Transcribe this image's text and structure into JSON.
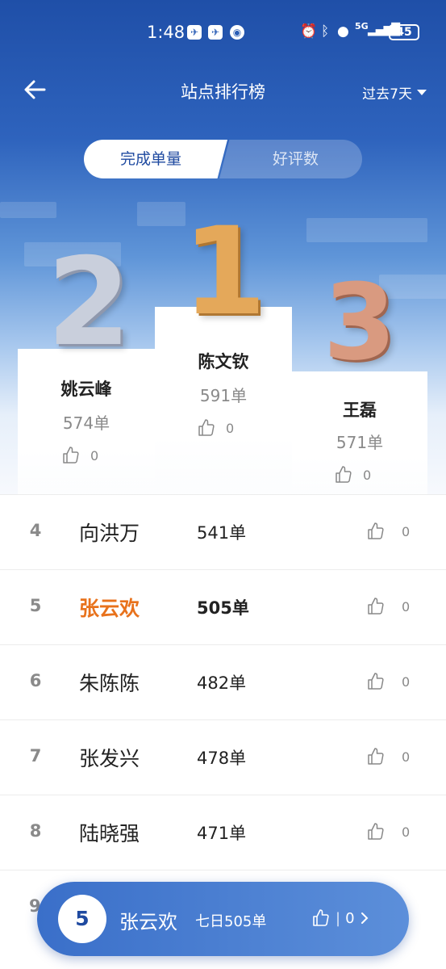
{
  "status_bar": {
    "time": "1:48",
    "battery": "45",
    "network": "5G"
  },
  "nav": {
    "title": "站点排行榜",
    "period": "过去7天"
  },
  "tabs": {
    "active": "完成单量",
    "inactive": "好评数"
  },
  "podium": {
    "first": {
      "rank_digit": "1",
      "name": "陈文钦",
      "count": "591单",
      "likes": "0"
    },
    "second": {
      "rank_digit": "2",
      "name": "姚云峰",
      "count": "574单",
      "likes": "0"
    },
    "third": {
      "rank_digit": "3",
      "name": "王磊",
      "count": "571单",
      "likes": "0"
    }
  },
  "list": [
    {
      "rank": "4",
      "name": "向洪万",
      "count": "541单",
      "likes": "0"
    },
    {
      "rank": "5",
      "name": "张云欢",
      "count": "505单",
      "likes": "0"
    },
    {
      "rank": "6",
      "name": "朱陈陈",
      "count": "482单",
      "likes": "0"
    },
    {
      "rank": "7",
      "name": "张发兴",
      "count": "478单",
      "likes": "0"
    },
    {
      "rank": "8",
      "name": "陆晓强",
      "count": "471单",
      "likes": "0"
    }
  ],
  "peek_rank": "9",
  "my_rank": {
    "rank": "5",
    "name": "张云欢",
    "summary": "七日505单",
    "likes": "0",
    "separator": "|"
  },
  "colors": {
    "accent": "#1f4aa0",
    "highlight": "#e8721c",
    "gold": "#e4a85a",
    "silver": "#c9cfdc",
    "bronze": "#d99a80"
  }
}
